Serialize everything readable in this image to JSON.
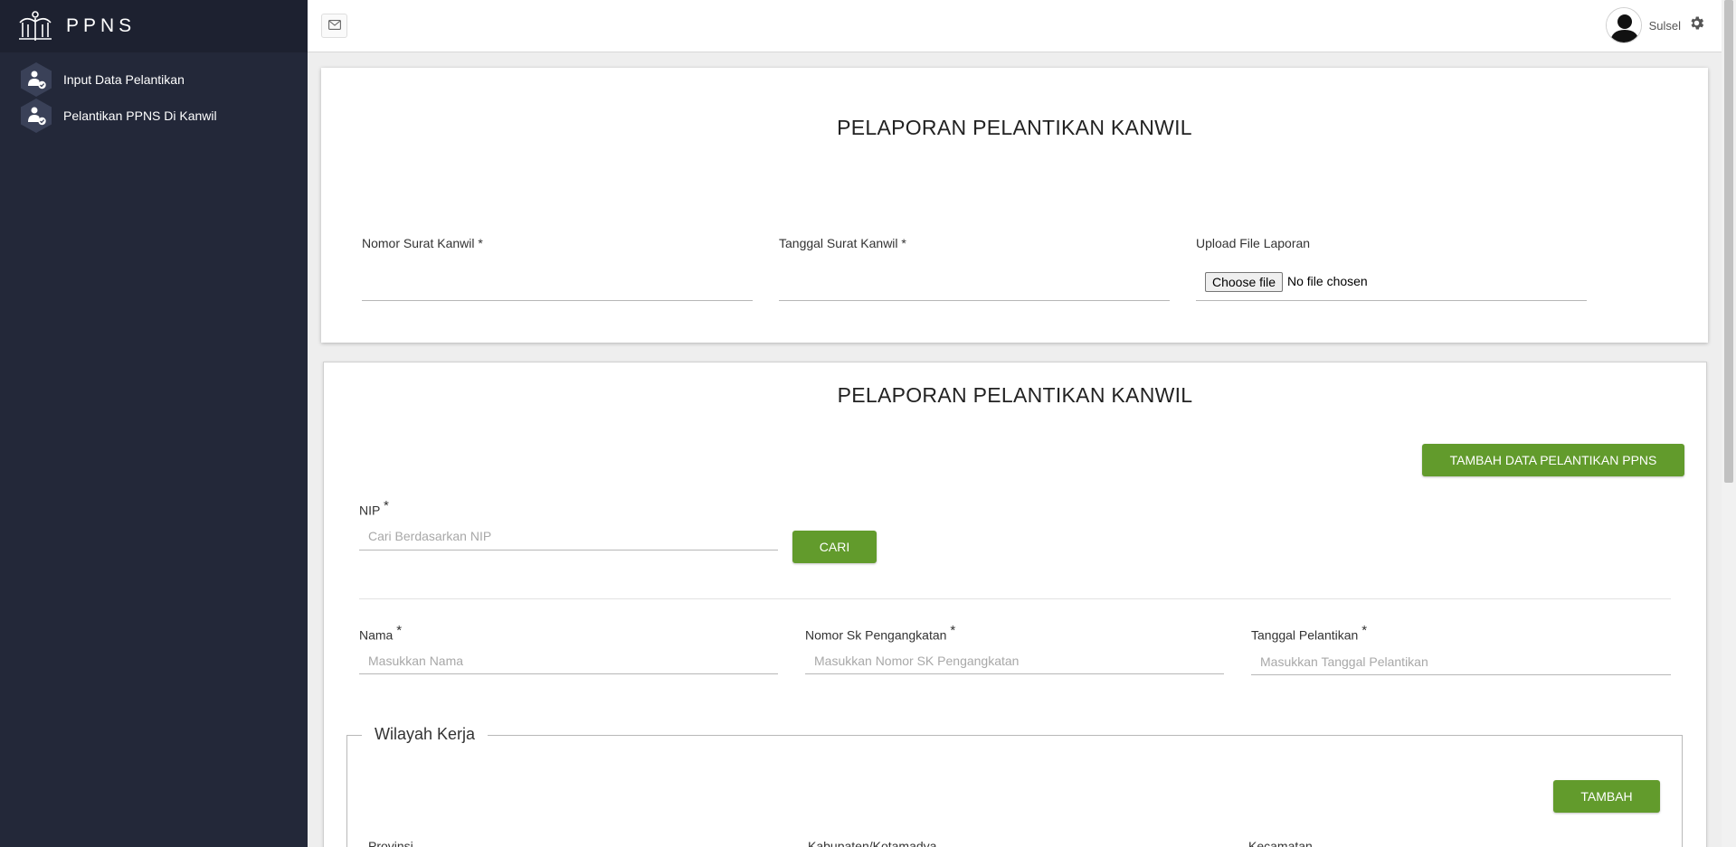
{
  "brand": {
    "title": "PPNS"
  },
  "sidebar": {
    "items": [
      {
        "label": "Input Data Pelantikan",
        "icon": "user-check-icon"
      },
      {
        "label": "Pelantikan PPNS Di Kanwil",
        "icon": "user-check-icon"
      }
    ]
  },
  "topbar": {
    "username": "Sulsel"
  },
  "card1": {
    "title": "PELAPORAN PELANTIKAN KANWIL",
    "nomor_surat_label": "Nomor Surat Kanwil *",
    "tanggal_surat_label": "Tanggal Surat Kanwil *",
    "upload_label": "Upload File Laporan",
    "file_button": "Choose file",
    "file_status": "No file chosen"
  },
  "card2": {
    "title": "PELAPORAN PELANTIKAN KANWIL",
    "tambah_data_button": "TAMBAH DATA PELANTIKAN PPNS",
    "nip_label": "NIP",
    "nip_placeholder": "Cari Berdasarkan NIP",
    "cari_button": "CARI",
    "nama_label": "Nama",
    "nama_placeholder": "Masukkan Nama",
    "nomor_sk_label": "Nomor Sk Pengangkatan",
    "nomor_sk_placeholder": "Masukkan Nomor SK Pengangkatan",
    "tanggal_pelantikan_label": "Tanggal Pelantikan",
    "tanggal_pelantikan_placeholder": "Masukkan Tanggal Pelantikan",
    "required_mark": "*",
    "wilayah": {
      "legend": "Wilayah Kerja",
      "tambah_button": "TAMBAH",
      "provinsi_label": "Provinsi",
      "kabupaten_label": "Kabupaten/Kotamadya",
      "kecamatan_label": "Kecamatan"
    }
  },
  "colors": {
    "sidebar_bg": "#232839",
    "brand_bg": "#1d2130",
    "accent_green": "#629b2c"
  }
}
